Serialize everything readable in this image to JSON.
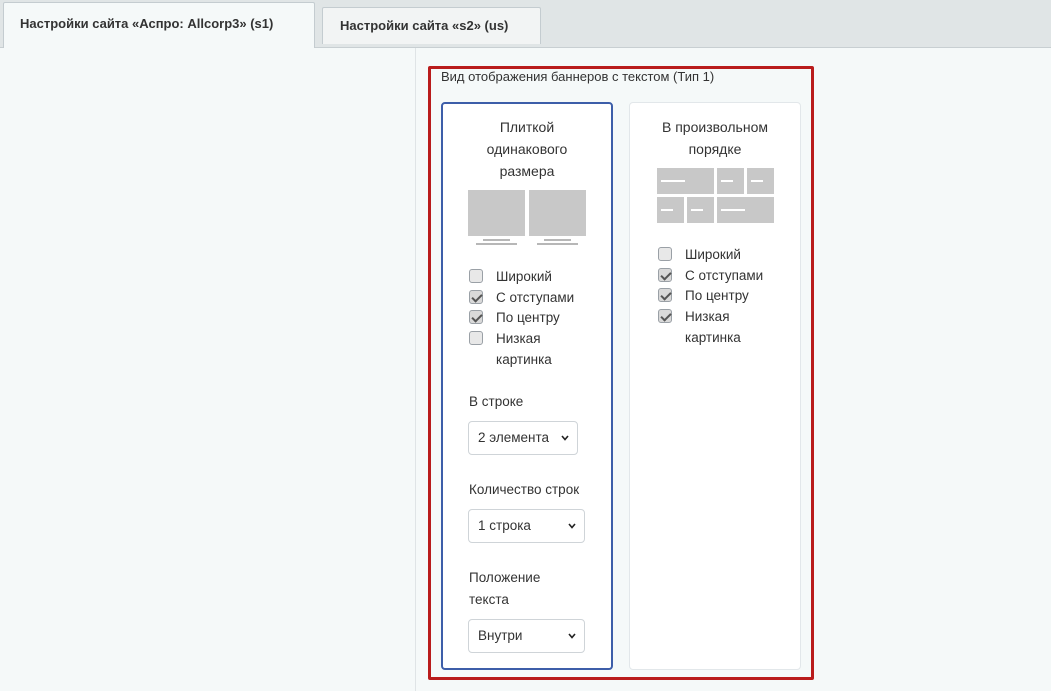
{
  "tabs": [
    {
      "label": "Настройки сайта «Аспро: Allcorp3» (s1)"
    },
    {
      "label": "Настройки сайта «s2» (us)"
    }
  ],
  "section": {
    "title": "Вид отображения баннеров с текстом (Тип 1)"
  },
  "card1": {
    "title_line1": "Плиткой",
    "title_line2": "одинакового",
    "title_line3": "размера",
    "checkboxes": [
      {
        "label": "Широкий",
        "checked": false
      },
      {
        "label": "С отступами",
        "checked": true
      },
      {
        "label": "По центру",
        "checked": true
      },
      {
        "label_line1": "Низкая",
        "label_line2": "картинка",
        "checked": false
      }
    ],
    "per_row_label": "В строке",
    "per_row_value": "2 элемента",
    "rows_label": "Количество строк",
    "rows_value": "1 строка",
    "text_pos_label_line1": "Положение",
    "text_pos_label_line2": "текста",
    "text_pos_value": "Внутри"
  },
  "card2": {
    "title_line1": "В произвольном",
    "title_line2": "порядке",
    "checkboxes": [
      {
        "label": "Широкий",
        "checked": false
      },
      {
        "label": "С отступами",
        "checked": true
      },
      {
        "label": "По центру",
        "checked": true
      },
      {
        "label_line1": "Низкая",
        "label_line2": "картинка",
        "checked": true
      }
    ]
  },
  "colors": {
    "selected_border": "#3d5ea9",
    "highlight": "#b91c1c"
  },
  "icons": {
    "dropdown": "chevron-down-icon",
    "checkbox_check": "check-icon"
  }
}
